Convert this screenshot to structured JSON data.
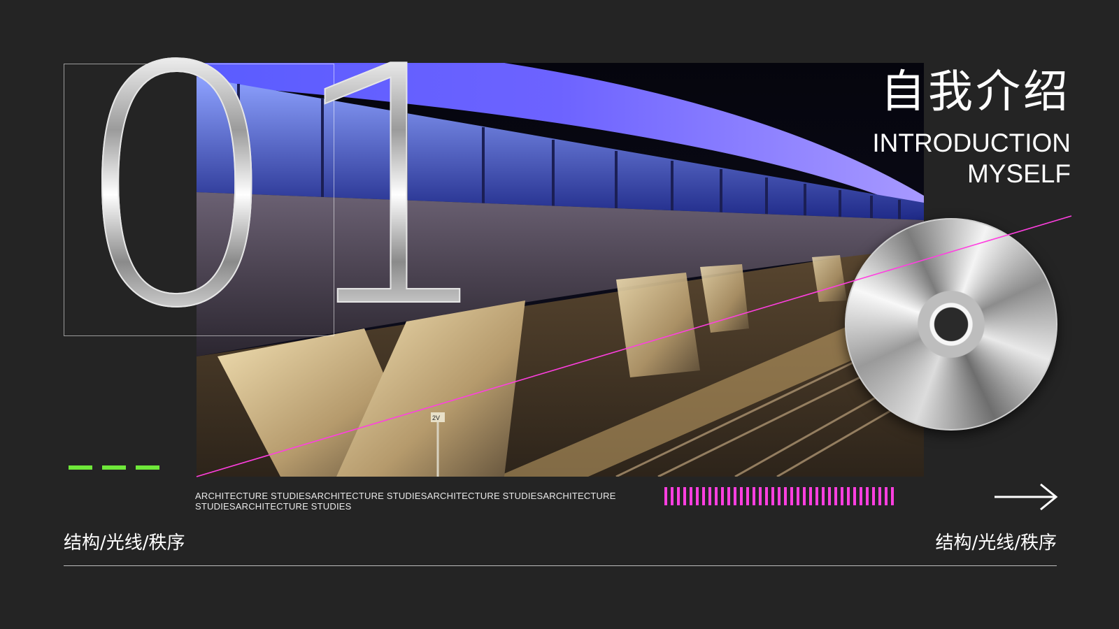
{
  "section_number": "01",
  "title_cn": "自我介绍",
  "title_en_line1": "INTRODUCTION",
  "title_en_line2": "MYSELF",
  "caption": "ARCHITECTURE STUDIESARCHITECTURE STUDIESARCHITECTURE STUDIESARCHITECTURE STUDIESARCHITECTURE STUDIES",
  "keywords_left": "结构/光线/秩序",
  "keywords_right": "结构/光线/秩序",
  "photo_sign_text": "2V",
  "icons": [
    "arrow-right-icon",
    "cd-disc-icon"
  ],
  "colors": {
    "background": "#242424",
    "accent_pink": "#ff3fe0",
    "accent_green": "#6fe83a",
    "text": "#ffffff",
    "canopy_blue": "#4b4cf5"
  }
}
